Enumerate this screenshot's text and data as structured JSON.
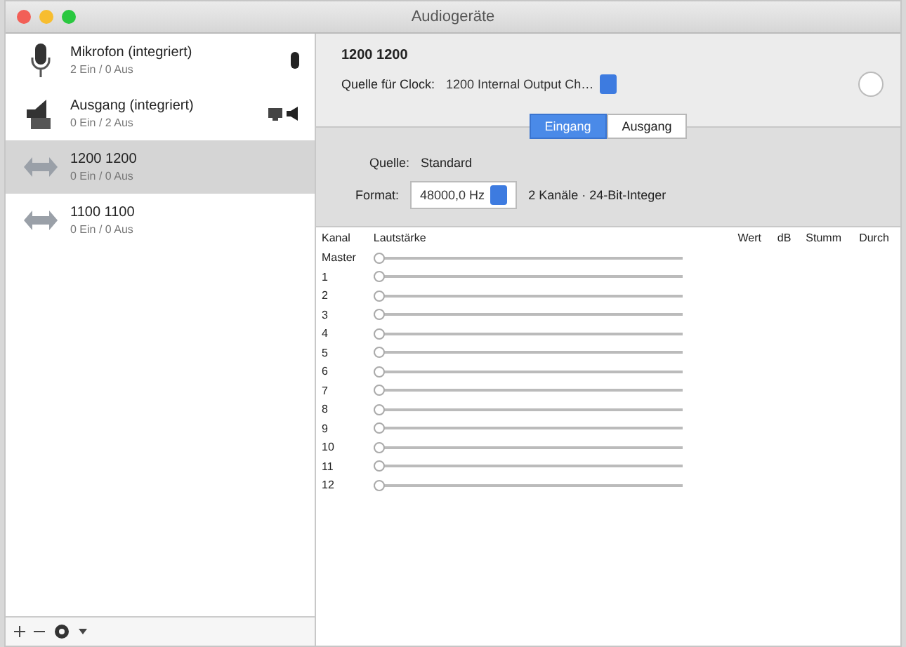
{
  "window": {
    "title": "Audiogeräte"
  },
  "sidebar": {
    "items": [
      {
        "kind": "mic",
        "name": "Mikrofon (integriert)",
        "detail": "2 Ein / 0 Aus",
        "selected": false
      },
      {
        "kind": "speaker",
        "name": "Ausgang (integriert)",
        "detail": "0 Ein / 2 Aus",
        "selected": false
      },
      {
        "kind": "aggregate",
        "name": "1200 1200",
        "detail": "0 Ein / 0 Aus",
        "selected": true
      },
      {
        "kind": "aggregate",
        "name": "1100 1100",
        "detail": "0 Ein / 0 Aus",
        "selected": false
      }
    ]
  },
  "device": {
    "name": "1200 1200",
    "clock_label": "Quelle für Clock:",
    "clock_value": "1200 Internal Output Ch…"
  },
  "tabs": [
    {
      "label": "Eingang",
      "selected": true
    },
    {
      "label": "Ausgang",
      "selected": false
    }
  ],
  "source": {
    "label": "Quelle:",
    "value": "Standard"
  },
  "format": {
    "label": "Format:",
    "value": "48000,0 Hz",
    "detail": "2 Kanäle · 24-Bit-Integer"
  },
  "table": {
    "columns": [
      "Kanal",
      "Lautstärke",
      "Wert",
      "dB",
      "Stumm",
      "Durch"
    ],
    "rows": [
      {
        "channel": "Master",
        "level": 0
      },
      {
        "channel": "1",
        "level": 0
      },
      {
        "channel": "2",
        "level": 0
      },
      {
        "channel": "3",
        "level": 0
      },
      {
        "channel": "4",
        "level": 0
      },
      {
        "channel": "5",
        "level": 0
      },
      {
        "channel": "6",
        "level": 0
      },
      {
        "channel": "7",
        "level": 0
      },
      {
        "channel": "8",
        "level": 0
      },
      {
        "channel": "9",
        "level": 0
      },
      {
        "channel": "10",
        "level": 0
      },
      {
        "channel": "11",
        "level": 0
      },
      {
        "channel": "12",
        "level": 0
      }
    ]
  }
}
